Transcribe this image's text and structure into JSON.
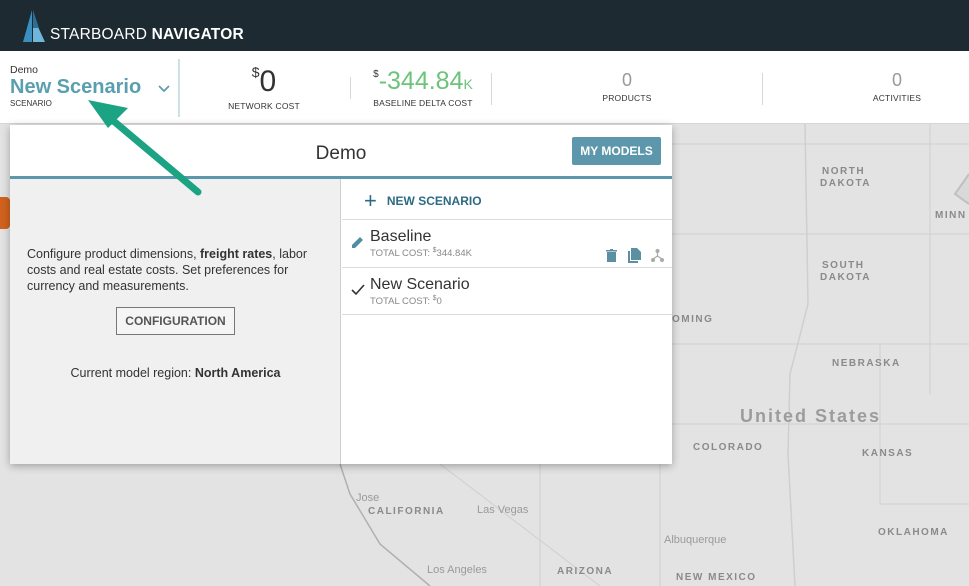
{
  "app": {
    "brand_light": "STARBOARD ",
    "brand_bold": "NAVIGATOR"
  },
  "scenario": {
    "model_name": "Demo",
    "name": "New Scenario",
    "label": "SCENARIO"
  },
  "stats": {
    "network_cost": {
      "currency": "$",
      "value": "0",
      "label": "NETWORK COST"
    },
    "baseline_delta": {
      "currency": "$",
      "value": "-344.84",
      "suffix": "K",
      "label": "BASELINE DELTA COST"
    },
    "products": {
      "value": "0",
      "label": "PRODUCTS"
    },
    "activities": {
      "value": "0",
      "label": "ACTIVITIES"
    }
  },
  "panel": {
    "title": "Demo",
    "my_models_label": "MY MODELS",
    "config_text_1": "Configure product dimensions, ",
    "config_text_bold": "freight rates",
    "config_text_2": ", labor costs and real estate costs. Set preferences for currency and measurements.",
    "config_button_label": "CONFIGURATION",
    "region_prefix": "Current model region: ",
    "region_value": "North America",
    "new_scenario_label": "NEW SCENARIO",
    "scenarios": [
      {
        "name": "Baseline",
        "cost_prefix": "TOTAL COST: ",
        "currency": "$",
        "cost": "344.84",
        "suffix": "K",
        "state": "edit"
      },
      {
        "name": "New Scenario",
        "cost_prefix": "TOTAL COST: ",
        "currency": "$",
        "cost": "0",
        "suffix": "",
        "state": "selected"
      }
    ]
  },
  "map": {
    "labels": {
      "north_dakota_1": "NORTH",
      "north_dakota_2": "DAKOTA",
      "minn": "MINN",
      "south_dakota_1": "SOUTH",
      "south_dakota_2": "DAKOTA",
      "wyoming": "OMING",
      "nebraska": "NEBRASKA",
      "united_states": "United States",
      "colorado": "COLORADO",
      "kansas": "KANSAS",
      "jose": "Jose",
      "california": "CALIFORNIA",
      "las_vegas": "Las Vegas",
      "albuquerque": "Albuquerque",
      "oklahoma": "OKLAHOMA",
      "arizona": "ARIZONA",
      "new_mexico": "NEW MEXICO",
      "los_angeles": "Los Angeles"
    }
  },
  "colors": {
    "topbar": "#1d2a31",
    "accent": "#5d97ab",
    "scenario_name": "#5a9fb0",
    "delta_green": "#6cc47a",
    "annotation_arrow": "#1ba384"
  }
}
